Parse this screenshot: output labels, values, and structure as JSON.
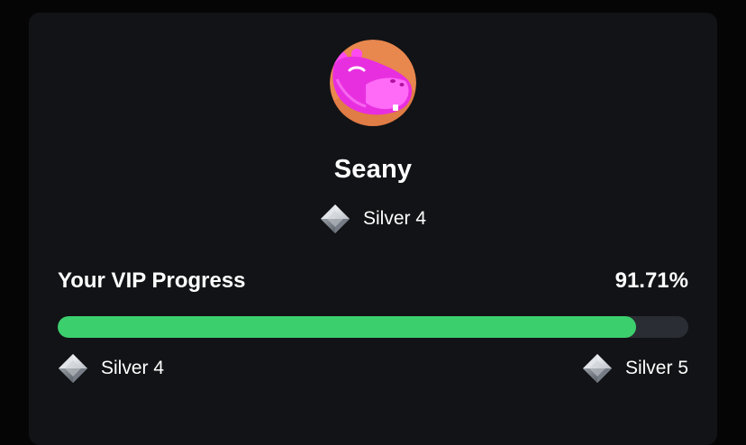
{
  "profile": {
    "username": "Seany",
    "avatar_icon": "hippo-avatar-icon",
    "current_tier": "Silver 4"
  },
  "vip_progress": {
    "title": "Your VIP Progress",
    "percent_label": "91.71%",
    "percent": 91.71,
    "current_level": "Silver 4",
    "next_level": "Silver 5",
    "level_icon": "silver-diamond-icon"
  },
  "colors": {
    "card_background": "#121316",
    "page_background": "#050506",
    "progress_fill": "#3ccf6e",
    "progress_track": "#2a2d33",
    "avatar_background": "#e8874e",
    "avatar_character": "#e82fe0"
  }
}
